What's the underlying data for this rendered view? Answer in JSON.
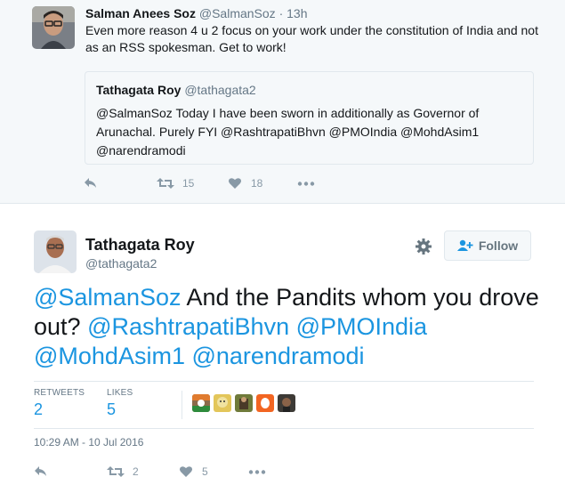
{
  "quoted_parent": {
    "author_name": "Salman Anees Soz",
    "author_handle": "@SalmanSoz",
    "separator": "·",
    "time": "13h",
    "text": "Even more reason 4 u 2 focus on your work under the constitution of India and not as an RSS spokesman. Get to work!",
    "quote": {
      "author_name": "Tathagata Roy",
      "author_handle": "@tathagata2",
      "text": "@SalmanSoz Today I have been sworn in additionally as Governor of Arunachal. Purely FYI @RashtrapatiBhvn @PMOIndia @MohdAsim1 @narendramodi"
    },
    "actions": {
      "retweets": "15",
      "likes": "18"
    }
  },
  "main_tweet": {
    "author_name": "Tathagata Roy",
    "author_handle": "@tathagata2",
    "follow_label": "Follow",
    "text_parts": [
      {
        "text": "@SalmanSoz",
        "mention": true
      },
      {
        "text": " And the Pandits whom you drove out? ",
        "mention": false
      },
      {
        "text": "@RashtrapatiBhvn",
        "mention": true
      },
      {
        "text": " ",
        "mention": false
      },
      {
        "text": "@PMOIndia",
        "mention": true
      },
      {
        "text": " ",
        "mention": false
      },
      {
        "text": "@MohdAsim1",
        "mention": true
      },
      {
        "text": " ",
        "mention": false
      },
      {
        "text": "@narendramodi",
        "mention": true
      }
    ],
    "stats": {
      "retweets_label": "RETWEETS",
      "retweets_value": "2",
      "likes_label": "LIKES",
      "likes_value": "5"
    },
    "timestamp": "10:29 AM - 10 Jul 2016",
    "actions": {
      "retweets": "2",
      "likes": "5"
    }
  },
  "colors": {
    "accent": "#1b95e0",
    "muted": "#8899a6",
    "background_top": "#f5f8fa",
    "border": "#e1e8ed"
  },
  "icons": [
    "reply-icon",
    "retweet-icon",
    "heart-icon",
    "more-icon",
    "gear-icon",
    "follow-user-icon"
  ]
}
